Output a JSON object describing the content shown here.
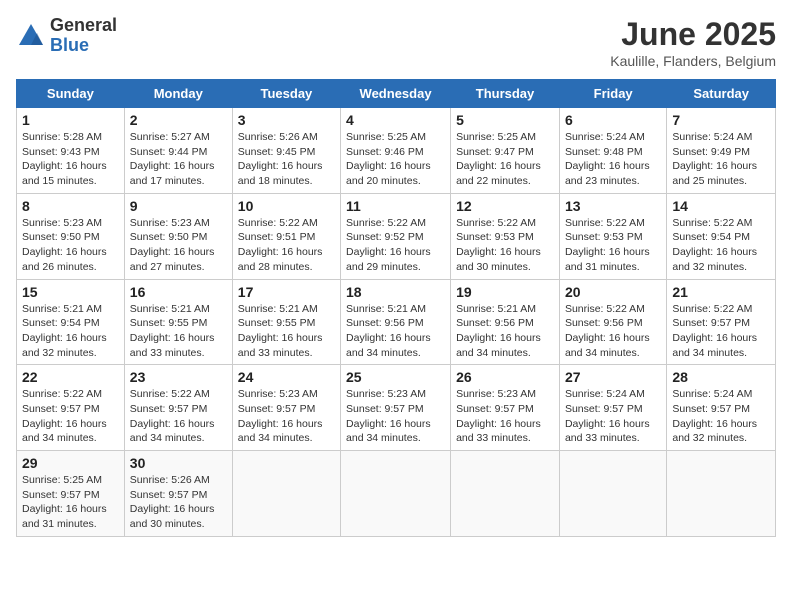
{
  "header": {
    "logo_general": "General",
    "logo_blue": "Blue",
    "month_title": "June 2025",
    "location": "Kaulille, Flanders, Belgium"
  },
  "days_of_week": [
    "Sunday",
    "Monday",
    "Tuesday",
    "Wednesday",
    "Thursday",
    "Friday",
    "Saturday"
  ],
  "weeks": [
    [
      {
        "day": "1",
        "sunrise": "5:28 AM",
        "sunset": "9:43 PM",
        "daylight": "16 hours and 15 minutes."
      },
      {
        "day": "2",
        "sunrise": "5:27 AM",
        "sunset": "9:44 PM",
        "daylight": "16 hours and 17 minutes."
      },
      {
        "day": "3",
        "sunrise": "5:26 AM",
        "sunset": "9:45 PM",
        "daylight": "16 hours and 18 minutes."
      },
      {
        "day": "4",
        "sunrise": "5:25 AM",
        "sunset": "9:46 PM",
        "daylight": "16 hours and 20 minutes."
      },
      {
        "day": "5",
        "sunrise": "5:25 AM",
        "sunset": "9:47 PM",
        "daylight": "16 hours and 22 minutes."
      },
      {
        "day": "6",
        "sunrise": "5:24 AM",
        "sunset": "9:48 PM",
        "daylight": "16 hours and 23 minutes."
      },
      {
        "day": "7",
        "sunrise": "5:24 AM",
        "sunset": "9:49 PM",
        "daylight": "16 hours and 25 minutes."
      }
    ],
    [
      {
        "day": "8",
        "sunrise": "5:23 AM",
        "sunset": "9:50 PM",
        "daylight": "16 hours and 26 minutes."
      },
      {
        "day": "9",
        "sunrise": "5:23 AM",
        "sunset": "9:50 PM",
        "daylight": "16 hours and 27 minutes."
      },
      {
        "day": "10",
        "sunrise": "5:22 AM",
        "sunset": "9:51 PM",
        "daylight": "16 hours and 28 minutes."
      },
      {
        "day": "11",
        "sunrise": "5:22 AM",
        "sunset": "9:52 PM",
        "daylight": "16 hours and 29 minutes."
      },
      {
        "day": "12",
        "sunrise": "5:22 AM",
        "sunset": "9:53 PM",
        "daylight": "16 hours and 30 minutes."
      },
      {
        "day": "13",
        "sunrise": "5:22 AM",
        "sunset": "9:53 PM",
        "daylight": "16 hours and 31 minutes."
      },
      {
        "day": "14",
        "sunrise": "5:22 AM",
        "sunset": "9:54 PM",
        "daylight": "16 hours and 32 minutes."
      }
    ],
    [
      {
        "day": "15",
        "sunrise": "5:21 AM",
        "sunset": "9:54 PM",
        "daylight": "16 hours and 32 minutes."
      },
      {
        "day": "16",
        "sunrise": "5:21 AM",
        "sunset": "9:55 PM",
        "daylight": "16 hours and 33 minutes."
      },
      {
        "day": "17",
        "sunrise": "5:21 AM",
        "sunset": "9:55 PM",
        "daylight": "16 hours and 33 minutes."
      },
      {
        "day": "18",
        "sunrise": "5:21 AM",
        "sunset": "9:56 PM",
        "daylight": "16 hours and 34 minutes."
      },
      {
        "day": "19",
        "sunrise": "5:21 AM",
        "sunset": "9:56 PM",
        "daylight": "16 hours and 34 minutes."
      },
      {
        "day": "20",
        "sunrise": "5:22 AM",
        "sunset": "9:56 PM",
        "daylight": "16 hours and 34 minutes."
      },
      {
        "day": "21",
        "sunrise": "5:22 AM",
        "sunset": "9:57 PM",
        "daylight": "16 hours and 34 minutes."
      }
    ],
    [
      {
        "day": "22",
        "sunrise": "5:22 AM",
        "sunset": "9:57 PM",
        "daylight": "16 hours and 34 minutes."
      },
      {
        "day": "23",
        "sunrise": "5:22 AM",
        "sunset": "9:57 PM",
        "daylight": "16 hours and 34 minutes."
      },
      {
        "day": "24",
        "sunrise": "5:23 AM",
        "sunset": "9:57 PM",
        "daylight": "16 hours and 34 minutes."
      },
      {
        "day": "25",
        "sunrise": "5:23 AM",
        "sunset": "9:57 PM",
        "daylight": "16 hours and 34 minutes."
      },
      {
        "day": "26",
        "sunrise": "5:23 AM",
        "sunset": "9:57 PM",
        "daylight": "16 hours and 33 minutes."
      },
      {
        "day": "27",
        "sunrise": "5:24 AM",
        "sunset": "9:57 PM",
        "daylight": "16 hours and 33 minutes."
      },
      {
        "day": "28",
        "sunrise": "5:24 AM",
        "sunset": "9:57 PM",
        "daylight": "16 hours and 32 minutes."
      }
    ],
    [
      {
        "day": "29",
        "sunrise": "5:25 AM",
        "sunset": "9:57 PM",
        "daylight": "16 hours and 31 minutes."
      },
      {
        "day": "30",
        "sunrise": "5:26 AM",
        "sunset": "9:57 PM",
        "daylight": "16 hours and 30 minutes."
      },
      null,
      null,
      null,
      null,
      null
    ]
  ],
  "labels": {
    "sunrise": "Sunrise:",
    "sunset": "Sunset:",
    "daylight": "Daylight:"
  }
}
